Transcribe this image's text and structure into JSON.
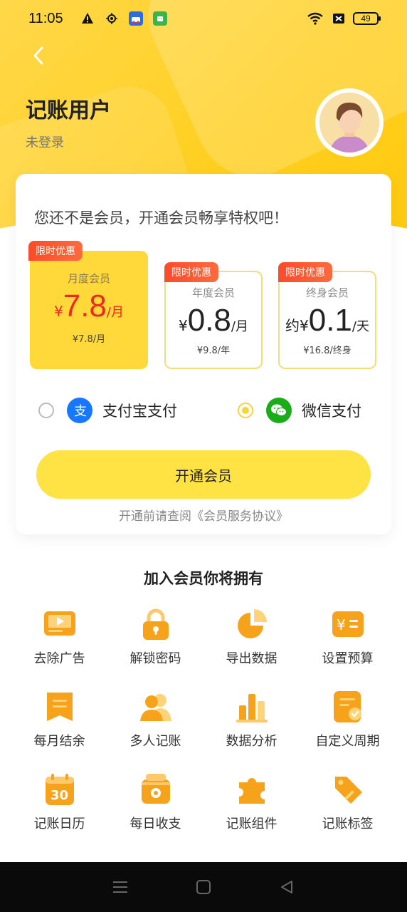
{
  "status_bar": {
    "time": "11:05",
    "battery": "49"
  },
  "user": {
    "name": "记账用户",
    "login_status": "未登录"
  },
  "card": {
    "title": "您还不是会员，开通会员畅享特权吧！",
    "plans": [
      {
        "tag": "限时优惠",
        "name": "月度会员",
        "prefix": "¥",
        "price": "7.8",
        "unit": "/月",
        "sub": "¥7.8/月",
        "selected": true
      },
      {
        "tag": "限时优惠",
        "name": "年度会员",
        "prefix": "¥",
        "price": "0.8",
        "unit": "/月",
        "sub": "¥9.8/年",
        "selected": false
      },
      {
        "tag": "限时优惠",
        "name": "终身会员",
        "prefix": "约¥",
        "price": "0.1",
        "unit": "/天",
        "sub": "¥16.8/终身",
        "selected": false
      }
    ],
    "payments": [
      {
        "label": "支付宝支付",
        "icon": "alipay-icon",
        "selected": false
      },
      {
        "label": "微信支付",
        "icon": "wechat-icon",
        "selected": true
      }
    ],
    "open_button": "开通会员",
    "agreement": "开通前请查阅《会员服务协议》"
  },
  "benefits": {
    "title": "加入会员你将拥有",
    "items": [
      {
        "label": "去除广告",
        "icon": "remove-ads-icon"
      },
      {
        "label": "解锁密码",
        "icon": "lock-icon"
      },
      {
        "label": "导出数据",
        "icon": "pie-chart-icon"
      },
      {
        "label": "设置预算",
        "icon": "budget-icon"
      },
      {
        "label": "每月结余",
        "icon": "monthly-balance-icon"
      },
      {
        "label": "多人记账",
        "icon": "people-icon"
      },
      {
        "label": "数据分析",
        "icon": "bar-chart-icon"
      },
      {
        "label": "自定义周期",
        "icon": "custom-cycle-icon"
      },
      {
        "label": "记账日历",
        "icon": "calendar-icon"
      },
      {
        "label": "每日收支",
        "icon": "daily-box-icon"
      },
      {
        "label": "记账组件",
        "icon": "puzzle-icon"
      },
      {
        "label": "记账标签",
        "icon": "tag-icon"
      }
    ],
    "calendar_day": "30"
  },
  "colors": {
    "accent": "#ffd93a",
    "price_red": "#f0281e",
    "icon_orange": "#f7a21b"
  }
}
